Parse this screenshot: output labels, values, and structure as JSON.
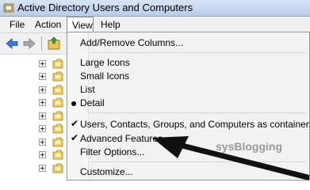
{
  "window": {
    "title": "Active Directory Users and Computers"
  },
  "menubar": {
    "items": [
      "File",
      "Action",
      "View",
      "Help"
    ]
  },
  "view_menu": {
    "items": [
      {
        "label": "Add/Remove Columns...",
        "mark": "none"
      },
      {
        "label": "Large Icons",
        "mark": "none"
      },
      {
        "label": "Small Icons",
        "mark": "none"
      },
      {
        "label": "List",
        "mark": "none"
      },
      {
        "label": "Detail",
        "mark": "bullet"
      },
      {
        "label": "Users, Contacts, Groups, and Computers as containers",
        "mark": "check"
      },
      {
        "label": "Advanced Features",
        "mark": "check"
      },
      {
        "label": "Filter Options...",
        "mark": "none"
      },
      {
        "label": "Customize...",
        "mark": "none"
      }
    ]
  },
  "watermark": "sysBlogging",
  "icons": [
    "app-icon",
    "back-arrow-icon",
    "forward-arrow-icon",
    "up-folder-icon",
    "expand-plus-icon",
    "folder-icon",
    "checkmark-icon",
    "radio-bullet-icon",
    "annotation-arrow"
  ],
  "colors": {
    "accent": "#3a7bd5",
    "arrow": "#111111",
    "watermark": "#9a9a9a"
  }
}
